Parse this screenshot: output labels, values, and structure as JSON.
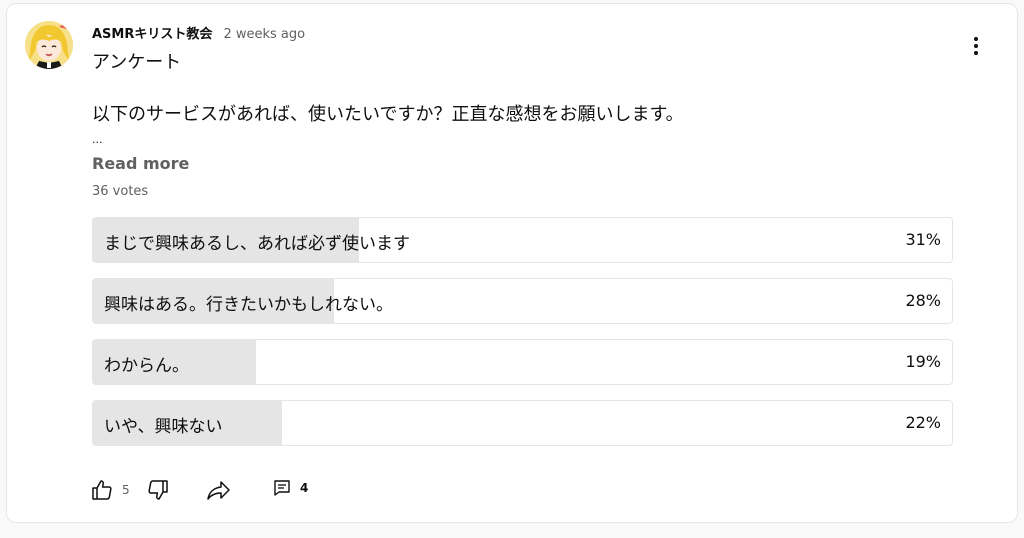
{
  "post": {
    "channel": "ASMRキリスト教会",
    "time": "2 weeks ago",
    "title": "アンケート",
    "body": "以下のサービスがあれば、使いたいですか？正直な感想をお願いします。",
    "ellipsis": "...",
    "read_more": "Read more",
    "votes": "36 votes",
    "menu_icon": "more-vert-icon"
  },
  "poll": [
    {
      "label": "まじで興味あるし、あれば必ず使います",
      "pct_text": "31%",
      "fraction": 0.31
    },
    {
      "label": "興味はある。行きたいかもしれない。",
      "pct_text": "28%",
      "fraction": 0.28
    },
    {
      "label": "わからん。",
      "pct_text": "19%",
      "fraction": 0.19
    },
    {
      "label": "いや、興味ない",
      "pct_text": "22%",
      "fraction": 0.22
    }
  ],
  "actions": {
    "likes": "5",
    "replies": "4",
    "icons": [
      "thumb-up-icon",
      "thumb-down-icon",
      "share-icon",
      "comment-icon"
    ]
  },
  "colors": {
    "fill": "#e5e5e5",
    "border": "#e5e5e5",
    "text": "#0f0f0f",
    "secondary": "#606060"
  }
}
